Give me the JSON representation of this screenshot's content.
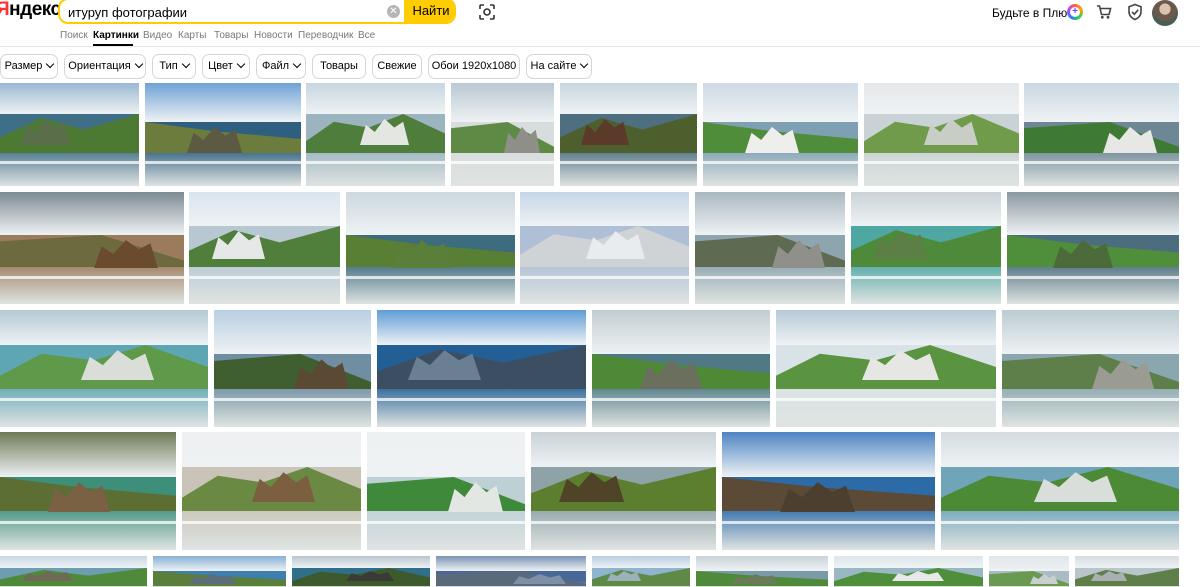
{
  "header": {
    "logo_first": "Я",
    "logo_rest": "ндекс",
    "search_value": "итуруп фотографии",
    "find_label": "Найти",
    "plus_label": "Будьте в Плюсе",
    "plus_badge": "+"
  },
  "tabs": [
    "Поиск",
    "Картинки",
    "Видео",
    "Карты",
    "Товары",
    "Новости",
    "Переводчик",
    "Все"
  ],
  "active_tab": "Картинки",
  "filters": [
    {
      "label": "Размер",
      "dropdown": true
    },
    {
      "label": "Ориентация",
      "dropdown": true
    },
    {
      "label": "Тип",
      "dropdown": true
    },
    {
      "label": "Цвет",
      "dropdown": true
    },
    {
      "label": "Файл",
      "dropdown": true
    },
    {
      "label": "Товары",
      "dropdown": false
    },
    {
      "label": "Свежие",
      "dropdown": false
    },
    {
      "label": "Обои 1920x1080",
      "dropdown": false
    },
    {
      "label": "На сайте",
      "dropdown": true
    }
  ],
  "colors": {
    "search_accent": "#ffcc00",
    "logo_red": "#ff3333",
    "tab_inactive": "#7a7a7a"
  },
  "image_rows": [
    [
      {
        "sky": "#9bb8d3",
        "sea": "#3f6f86",
        "land": "#4d7a32",
        "cliff": "#5a6e4a"
      },
      {
        "sky": "#6fa2d6",
        "sea": "#2e5f80",
        "land": "#6c7c3c",
        "cliff": "#5d5a44"
      },
      {
        "sky": "#c7d6df",
        "sea": "#9bb4bf",
        "land": "#4f7d3b",
        "cliff": "#e4e6e2"
      },
      {
        "sky": "#b9c8d2",
        "sea": "#d7dcdc",
        "land": "#5f8a45",
        "cliff": "#8e8f89"
      },
      {
        "sky": "#c8d7de",
        "sea": "#4d6f80",
        "land": "#4e5f2e",
        "cliff": "#5b3a2a"
      },
      {
        "sky": "#cfdbe6",
        "sea": "#7fa0b3",
        "land": "#4f8d3a",
        "cliff": "#eeeeec"
      },
      {
        "sky": "#e4e8ea",
        "sea": "#c9d2d4",
        "land": "#6f9b4a",
        "cliff": "#c8cdc6"
      },
      {
        "sky": "#c9d8e2",
        "sea": "#6d8795",
        "land": "#3f7a35",
        "cliff": "#e7e8e6"
      }
    ],
    [
      {
        "sky": "#7d8b93",
        "sea": "#9c7b5c",
        "land": "#6c6a3e",
        "cliff": "#6b4b2e"
      },
      {
        "sky": "#d9e5ee",
        "sea": "#b8c8d3",
        "land": "#4f7f3b",
        "cliff": "#e6e8e8"
      },
      {
        "sky": "#cdd8df",
        "sea": "#3e6c7f",
        "land": "#587f33",
        "cliff": "#5a7f3a"
      },
      {
        "sky": "#c6d6e8",
        "sea": "#aebfd6",
        "land": "#cfd3d6",
        "cliff": "#e9ecee"
      },
      {
        "sky": "#a9b8c1",
        "sea": "#8da5ae",
        "land": "#5f6a52",
        "cliff": "#8f9089"
      },
      {
        "sky": "#c9d3d6",
        "sea": "#4fa7a4",
        "land": "#4f8a3a",
        "cliff": "#5b7f44"
      },
      {
        "sky": "#8a98a0",
        "sea": "#4b6d7e",
        "land": "#4f8e3b",
        "cliff": "#4c6b3a"
      }
    ],
    [
      {
        "sky": "#b3cad4",
        "sea": "#5fa6b4",
        "land": "#5e9a4a",
        "cliff": "#d9dfd8"
      },
      {
        "sky": "#b9cfe3",
        "sea": "#6f8ea1",
        "land": "#3f5f31",
        "cliff": "#5b4a33"
      },
      {
        "sky": "#5f9dd6",
        "sea": "#235f94",
        "land": "#3c4f62",
        "cliff": "#6a7f92"
      },
      {
        "sky": "#c3ced2",
        "sea": "#4f7985",
        "land": "#4e8a35",
        "cliff": "#6b6f5e"
      },
      {
        "sky": "#b6cad6",
        "sea": "#d9e2e6",
        "land": "#5a9440",
        "cliff": "#e6e7e3"
      },
      {
        "sky": "#bccbd2",
        "sea": "#8aa6ae",
        "land": "#5e7f4a",
        "cliff": "#9a9c93"
      }
    ],
    [
      {
        "sky": "#6e7a56",
        "sea": "#3d8f7a",
        "land": "#5d6e35",
        "cliff": "#7a6143"
      },
      {
        "sky": "#eef0f1",
        "sea": "#c9c4b7",
        "land": "#6a8a44",
        "cliff": "#7c5f3f"
      },
      {
        "sky": "#eef1f2",
        "sea": "#bdd0d6",
        "land": "#3f8a3a",
        "cliff": "#e3e7e4"
      },
      {
        "sky": "#c8d2d6",
        "sea": "#8fa2a8",
        "land": "#5b7f2e",
        "cliff": "#4f4428"
      },
      {
        "sky": "#4d84c3",
        "sea": "#2d6aa8",
        "land": "#5a4a36",
        "cliff": "#4c3f2f"
      },
      {
        "sky": "#d4dde2",
        "sea": "#6fa4b9",
        "land": "#4c8a36",
        "cliff": "#dadedb"
      }
    ],
    [
      {
        "sky": "#c7d8e4",
        "sea": "#6e9db0",
        "land": "#4f8a3a",
        "cliff": "#6e6a55"
      },
      {
        "sky": "#88b0d4",
        "sea": "#3f7fb0",
        "land": "#5a7f3a",
        "cliff": "#5d6d7c"
      },
      {
        "sky": "#b8c6d0",
        "sea": "#2f6f8a",
        "land": "#3d5a2c",
        "cliff": "#3a3a36"
      },
      {
        "sky": "#7b93b3",
        "sea": "#49689a",
        "land": "#5a6a7a",
        "cliff": "#7e8fa8"
      },
      {
        "sky": "#b8cde0",
        "sea": "#8fb4cf",
        "land": "#5f8a45",
        "cliff": "#9fb0bd"
      },
      {
        "sky": "#c9d4d8",
        "sea": "#7a9aa6",
        "land": "#4e8a3a",
        "cliff": "#6d7a5a"
      },
      {
        "sky": "#dde6ea",
        "sea": "#9ab8c4",
        "land": "#4f8e3b",
        "cliff": "#e6e9e8"
      },
      {
        "sky": "#e1e6e8",
        "sea": "#a9bcc4",
        "land": "#6a9a52",
        "cliff": "#c9ced0"
      },
      {
        "sky": "#d7dde0",
        "sea": "#b8c6cc",
        "land": "#5e7f4a",
        "cliff": "#a8b0b2"
      }
    ]
  ]
}
